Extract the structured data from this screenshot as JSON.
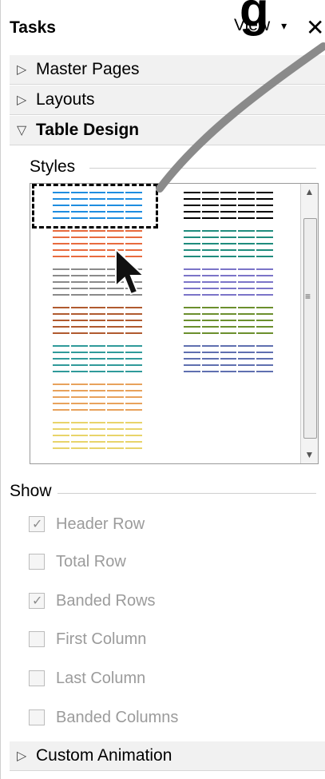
{
  "top_fragment": "g",
  "tasks": {
    "title": "Tasks",
    "view_label": "View",
    "view_arrow_icon": "chevron-down-icon",
    "close_label": "✕"
  },
  "sections": [
    {
      "label": "Master Pages",
      "expanded": false
    },
    {
      "label": "Layouts",
      "expanded": false
    },
    {
      "label": "Table Design",
      "expanded": true
    },
    {
      "label": "Custom Animation",
      "expanded": false
    }
  ],
  "styles_group": "Styles",
  "show_group": "Show",
  "style_gallery": {
    "selected_index": 0,
    "left_column": [
      {
        "name": "blue",
        "color": "#1e8de0"
      },
      {
        "name": "orange",
        "color": "#e86b3e"
      },
      {
        "name": "gray",
        "color": "#8a8a8a"
      },
      {
        "name": "brown",
        "color": "#b05a2f"
      },
      {
        "name": "teal",
        "color": "#2f9a9a"
      },
      {
        "name": "amber",
        "color": "#e8a25c"
      },
      {
        "name": "yellow",
        "color": "#e8d46a"
      }
    ],
    "right_column": [
      {
        "name": "black",
        "color": "#000000"
      },
      {
        "name": "teal",
        "color": "#1f8c7d"
      },
      {
        "name": "violet",
        "color": "#7b74c8"
      },
      {
        "name": "green",
        "color": "#6b8f2d"
      },
      {
        "name": "indigo",
        "color": "#5f6fb0"
      }
    ]
  },
  "show_options": [
    {
      "label": "Header Row",
      "checked": true
    },
    {
      "label": "Total Row",
      "checked": false
    },
    {
      "label": "Banded Rows",
      "checked": true
    },
    {
      "label": "First Column",
      "checked": false
    },
    {
      "label": "Last Column",
      "checked": false
    },
    {
      "label": "Banded Columns",
      "checked": false
    }
  ]
}
